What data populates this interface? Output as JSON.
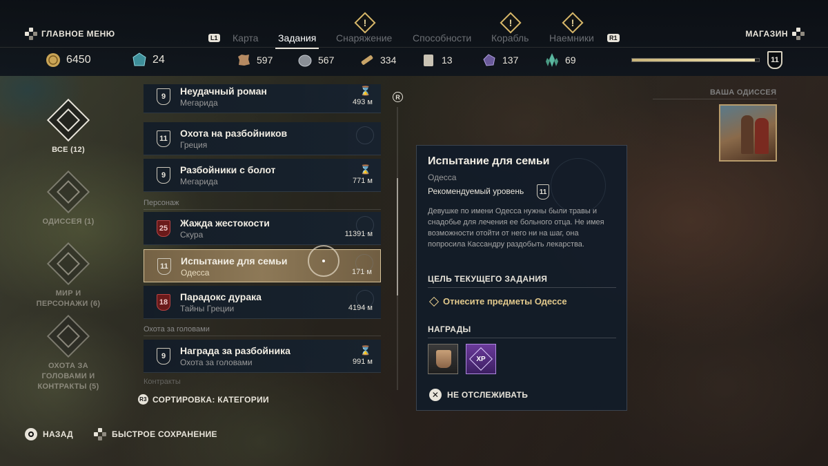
{
  "header": {
    "main_menu": "ГЛАВНОЕ МЕНЮ",
    "shop": "МАГАЗИН",
    "left_bumper": "L1",
    "right_bumper": "R1",
    "tabs": [
      {
        "label": "Карта",
        "active": false,
        "alert": false
      },
      {
        "label": "Задания",
        "active": true,
        "alert": false
      },
      {
        "label": "Снаряжение",
        "active": false,
        "alert": true
      },
      {
        "label": "Способности",
        "active": false,
        "alert": false
      },
      {
        "label": "Корабль",
        "active": false,
        "alert": true
      },
      {
        "label": "Наемники",
        "active": false,
        "alert": true
      }
    ]
  },
  "resources": {
    "drachmae": "6450",
    "orichalcum": "24",
    "leather": "597",
    "iron": "567",
    "wood": "334",
    "limestone": "13",
    "obsidian": "137",
    "crystal": "69",
    "level": "11",
    "xp_progress": 0.97
  },
  "categories": [
    {
      "label": "ВСЕ (12)",
      "active": true
    },
    {
      "label": "ОДИССЕЯ (1)",
      "active": false
    },
    {
      "label": "МИР И ПЕРСОНАЖИ (6)",
      "active": false
    },
    {
      "label": "ОХОТА ЗА ГОЛОВАМИ И КОНТРАКТЫ (5)",
      "active": false
    }
  ],
  "quest_list": {
    "sections": {
      "character": "Персонаж",
      "bounty": "Охота за головами",
      "contracts": "Контракты"
    },
    "quests": [
      {
        "level": "9",
        "title": "Неудачный роман",
        "location": "Мегарида",
        "distance": "493 м",
        "timed": true,
        "red": false
      },
      {
        "level": "11",
        "title": "Охота на разбойников",
        "location": "Греция",
        "distance": "",
        "timed": false,
        "red": false
      },
      {
        "level": "9",
        "title": "Разбойники с болот",
        "location": "Мегарида",
        "distance": "771 м",
        "timed": true,
        "red": false
      },
      {
        "level": "25",
        "title": "Жажда жестокости",
        "location": "Скура",
        "distance": "11391 м",
        "timed": false,
        "red": true
      },
      {
        "level": "11",
        "title": "Испытание для семьи",
        "location": "Одесса",
        "distance": "171 м",
        "timed": false,
        "red": false,
        "selected": true
      },
      {
        "level": "18",
        "title": "Парадокс дурака",
        "location": "Тайны Греции",
        "distance": "4194 м",
        "timed": false,
        "red": true
      },
      {
        "level": "9",
        "title": "Награда за разбойника",
        "location": "Охота за головами",
        "distance": "991 м",
        "timed": true,
        "red": false
      }
    ],
    "scroll_button": "R",
    "sort_button": "R3",
    "sort_label": "СОРТИРОВКА: КАТЕГОРИИ"
  },
  "detail": {
    "title": "Испытание для семьи",
    "location": "Одесса",
    "recommended_label": "Рекомендуемый уровень",
    "recommended_level": "11",
    "description": "Девушке по имени Одесса нужны были травы и снадобье для лечения ее больного отца. Не имея возможности отойти от него ни на шаг, она попросила Кассандру раздобыть лекарства.",
    "objective_header": "ЦЕЛЬ ТЕКУЩЕГО ЗАДАНИЯ",
    "objective": "Отнесите предметы Одессе",
    "rewards_header": "НАГРАДЫ",
    "rewards": [
      {
        "type": "gear-icon"
      },
      {
        "type": "xp",
        "label": "XP"
      }
    ],
    "untrack_label": "НЕ ОТСЛЕЖИВАТЬ"
  },
  "odyssey": {
    "label": "ВАША ОДИССЕЯ"
  },
  "footer": {
    "back_label": "НАЗАД",
    "quicksave_label": "БЫСТРОЕ СОХРАНЕНИЕ"
  },
  "colors": {
    "accent_gold": "#e2c98c",
    "panel_bg": "#121c28",
    "selected_row": "#96805c",
    "high_level_red": "#6a1a1a"
  }
}
